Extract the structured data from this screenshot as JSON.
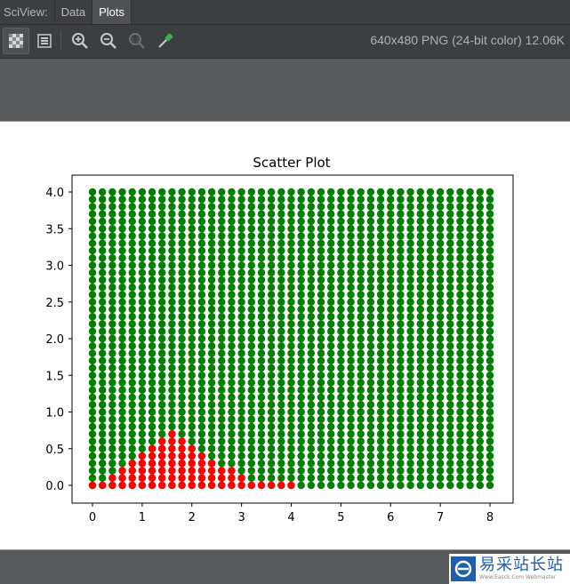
{
  "tabs": {
    "label": "SciView:",
    "items": [
      {
        "label": "Data",
        "active": false
      },
      {
        "label": "Plots",
        "active": true
      }
    ]
  },
  "toolbar": {
    "buttons": [
      {
        "icon": "checkerboard-icon",
        "selected": true
      },
      {
        "icon": "fit-to-frame-icon",
        "selected": false
      },
      {
        "icon": "zoom-in-icon",
        "selected": false
      },
      {
        "icon": "zoom-out-icon",
        "selected": false
      },
      {
        "icon": "actual-size-icon",
        "selected": false
      },
      {
        "icon": "color-picker-icon",
        "selected": false
      }
    ],
    "image_info": "640x480 PNG (24-bit color) 12.06K"
  },
  "watermark": {
    "main": "易采站长站",
    "sub": "Www.Easck.Com Webmaster"
  },
  "chart_data": {
    "type": "scatter",
    "title": "Scatter Plot",
    "xlim": [
      0,
      8
    ],
    "ylim": [
      0,
      4
    ],
    "xticks": [
      "0",
      "1",
      "2",
      "3",
      "4",
      "5",
      "6",
      "7",
      "8"
    ],
    "yticks": [
      "0.0",
      "0.5",
      "1.0",
      "1.5",
      "2.0",
      "2.5",
      "3.0",
      "3.5",
      "4.0"
    ],
    "grid": false,
    "colors": {
      "background_series": "#008000",
      "highlight_series": "#ff0000"
    },
    "series": [
      {
        "description_points": "grid of points x = 0..8 step 0.2, y = 0..4 step 0.1",
        "color": "#008000",
        "x_range": [
          0,
          8,
          0.2
        ],
        "y_range": [
          0,
          4,
          0.1
        ]
      },
      {
        "color": "#ff0000",
        "points_heights": [
          [
            0.0,
            0.0
          ],
          [
            0.2,
            0.0
          ],
          [
            0.4,
            0.1
          ],
          [
            0.6,
            0.2
          ],
          [
            0.8,
            0.3
          ],
          [
            1.0,
            0.4
          ],
          [
            1.2,
            0.5
          ],
          [
            1.4,
            0.6
          ],
          [
            1.6,
            0.7
          ],
          [
            1.8,
            0.6
          ],
          [
            2.0,
            0.5
          ],
          [
            2.2,
            0.4
          ],
          [
            2.4,
            0.3
          ],
          [
            2.6,
            0.2
          ],
          [
            2.8,
            0.2
          ],
          [
            3.0,
            0.1
          ],
          [
            3.2,
            0.0
          ],
          [
            3.4,
            0.0
          ],
          [
            3.6,
            0.0
          ],
          [
            3.8,
            0.0
          ],
          [
            4.0,
            0.0
          ]
        ]
      }
    ]
  }
}
